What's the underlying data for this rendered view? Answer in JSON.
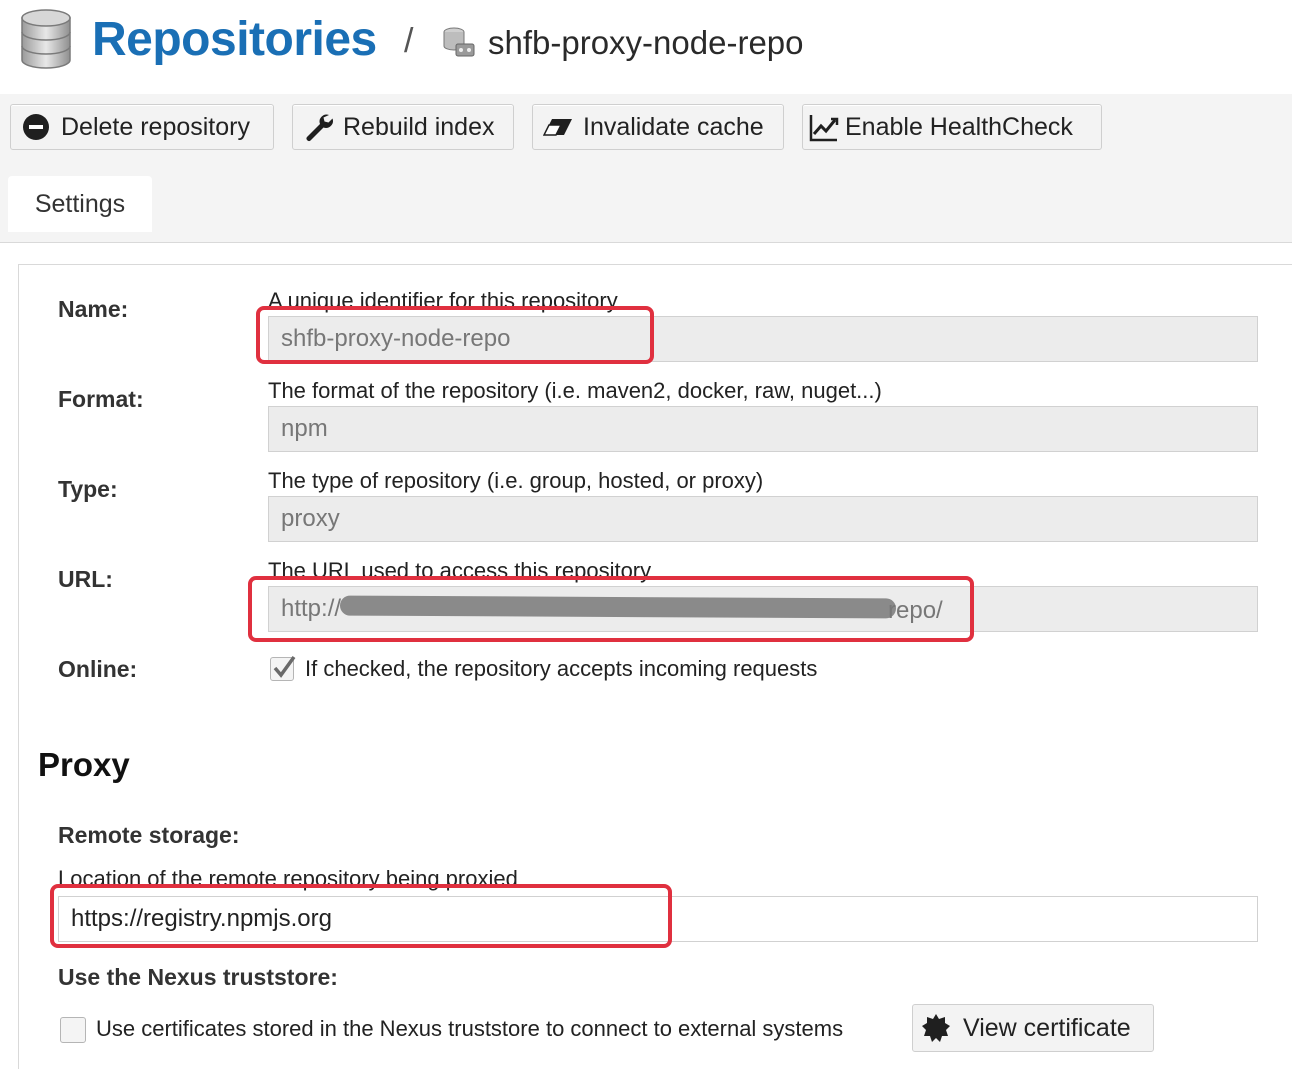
{
  "header": {
    "title": "Repositories",
    "separator": "/",
    "repo_name": "shfb-proxy-node-repo"
  },
  "toolbar": {
    "delete_label": "Delete repository",
    "rebuild_label": "Rebuild index",
    "invalidate_label": "Invalidate cache",
    "healthcheck_label": "Enable HealthCheck"
  },
  "tabs": [
    {
      "label": "Settings",
      "active": true
    }
  ],
  "form": {
    "name": {
      "label": "Name:",
      "help": "A unique identifier for this repository",
      "value": "shfb-proxy-node-repo"
    },
    "format": {
      "label": "Format:",
      "help": "The format of the repository (i.e. maven2, docker, raw, nuget...)",
      "value": "npm"
    },
    "type": {
      "label": "Type:",
      "help": "The type of repository (i.e. group, hosted, or proxy)",
      "value": "proxy"
    },
    "url": {
      "label": "URL:",
      "help": "The URL used to access this repository",
      "value_start": "http://",
      "value_end": "repo/"
    },
    "online": {
      "label": "Online:",
      "help": "If checked, the repository accepts incoming requests",
      "checked": true
    }
  },
  "proxy": {
    "section_title": "Proxy",
    "remote_storage": {
      "label": "Remote storage:",
      "help": "Location of the remote repository being proxied",
      "value": "https://registry.npmjs.org"
    },
    "truststore": {
      "label": "Use the Nexus truststore:",
      "help": "Use certificates stored in the Nexus truststore to connect to external systems",
      "checked": false,
      "button_label": "View certificate"
    }
  },
  "colors": {
    "title": "#1a6fb5",
    "highlight": "#e0303f",
    "toolbar_bg": "#f4f4f4",
    "readonly_field": "#ececec"
  },
  "icons": [
    "database-icon",
    "repo-icon",
    "minus-circle-icon",
    "wrench-icon",
    "eraser-icon",
    "line-chart-icon",
    "checkmark-icon",
    "certificate-icon"
  ]
}
